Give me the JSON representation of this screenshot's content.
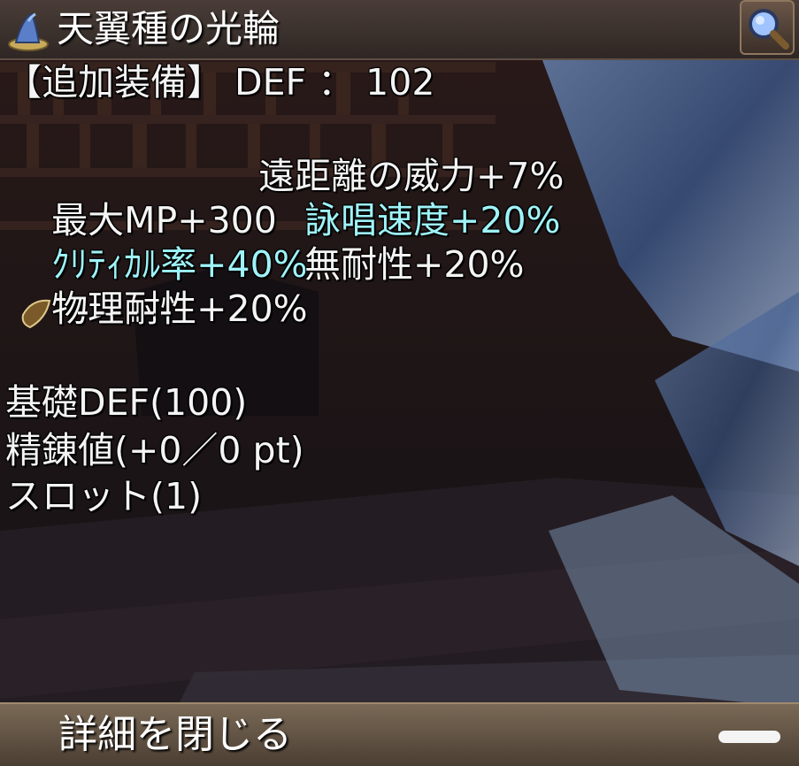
{
  "item": {
    "name": "天翼種の光輪"
  },
  "stats": {
    "extra_equip": "【追加装備】 DEF ： 102",
    "row1_col1": "最大MP+300",
    "row1_col2": "遠距離の威力+7%",
    "row2_col1": "ｸﾘﾃｨｶﾙ率+40%",
    "row2_col2": "詠唱速度+20%",
    "row3_col1": "物理耐性+20%",
    "row3_col2": "無耐性+20%",
    "slot_text": "------",
    "base_def": "基礎DEF(100)",
    "refine": "精錬値(+0／0 pt)",
    "slots": "スロット(1)"
  },
  "footer": {
    "close_label": "詳細を閉じる"
  },
  "colors": {
    "highlight_text": "#9ff3f8",
    "normal_text": "#f4f4f4",
    "title_bar": "#3c322e",
    "footer_bar": "#6a5a4a"
  },
  "icons": {
    "title": "wizard-hat-icon",
    "zoom": "magnifier-icon",
    "slot": "card-slot-icon"
  }
}
